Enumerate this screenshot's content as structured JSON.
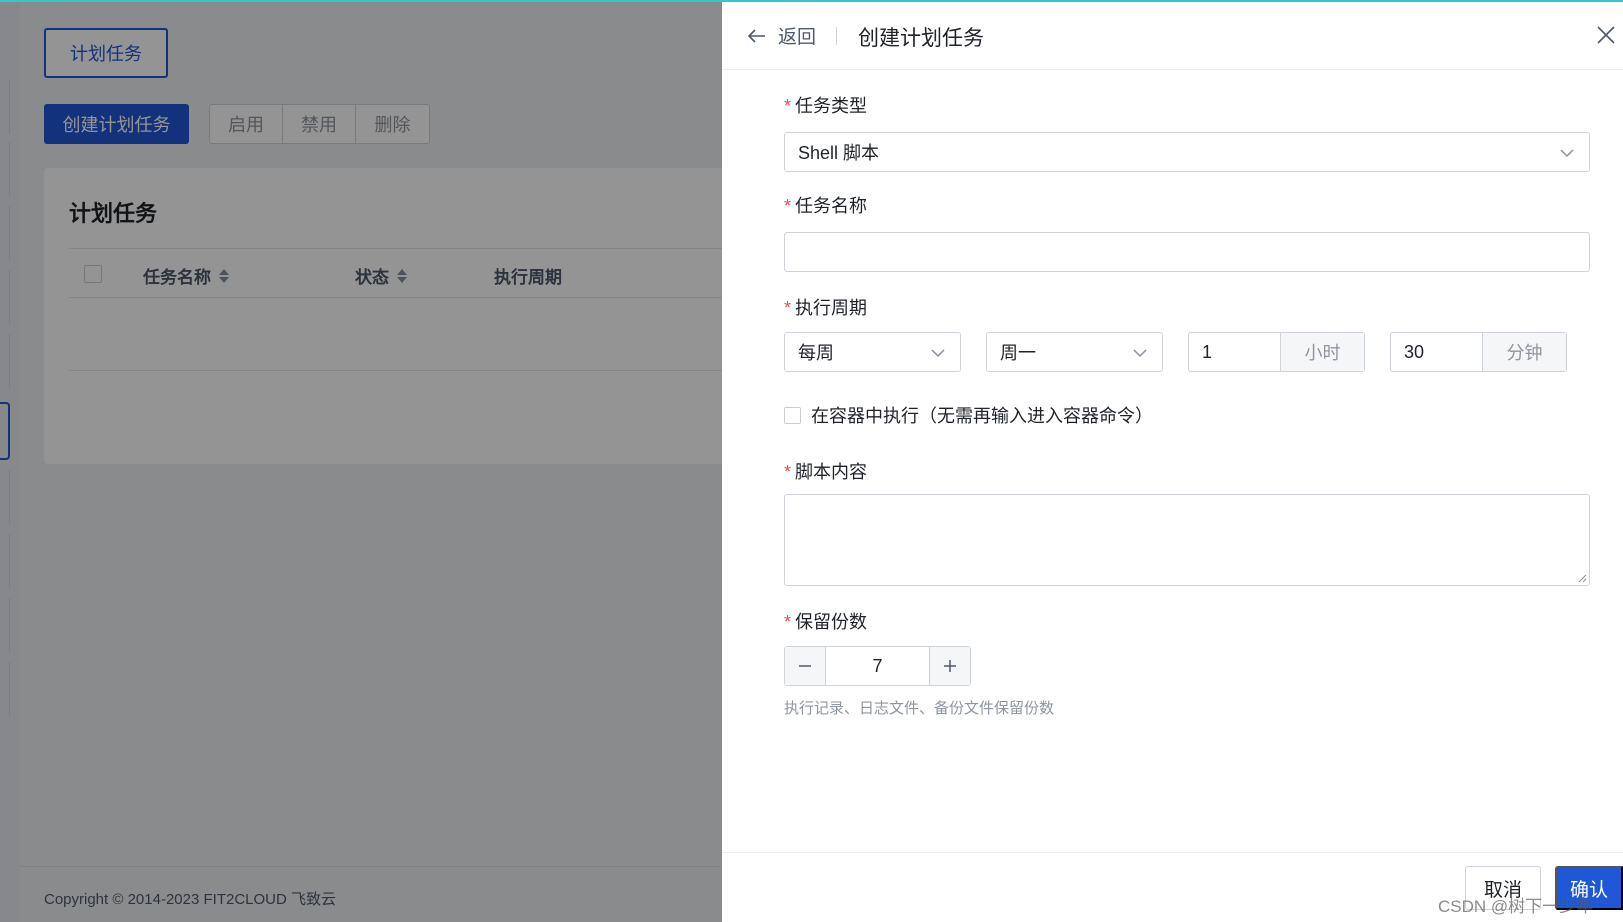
{
  "background": {
    "tab_label": "计划任务",
    "create_button": "创建计划任务",
    "actions": [
      "启用",
      "禁用",
      "删除"
    ],
    "card_title": "计划任务",
    "columns": [
      "任务名称",
      "状态",
      "执行周期"
    ],
    "copyright": "Copyright © 2014-2023 FIT2CLOUD 飞致云"
  },
  "drawer": {
    "back_label": "返回",
    "title": "创建计划任务",
    "task_type": {
      "label": "任务类型",
      "value": "Shell 脚本"
    },
    "task_name": {
      "label": "任务名称",
      "value": ""
    },
    "cycle": {
      "label": "执行周期",
      "frequency": "每周",
      "weekday": "周一",
      "hour": "1",
      "hour_unit": "小时",
      "minute": "30",
      "minute_unit": "分钟"
    },
    "in_container_label": "在容器中执行（无需再输入进入容器命令）",
    "script": {
      "label": "脚本内容",
      "value": ""
    },
    "retain": {
      "label": "保留份数",
      "value": "7",
      "help": "执行记录、日志文件、备份文件保留份数"
    },
    "cancel_label": "取消",
    "confirm_label": "确认"
  },
  "watermark": "CSDN @树下一少年",
  "colors": {
    "primary": "#1f57d6",
    "required": "#f54a45",
    "top_accent": "#34c8c8"
  }
}
